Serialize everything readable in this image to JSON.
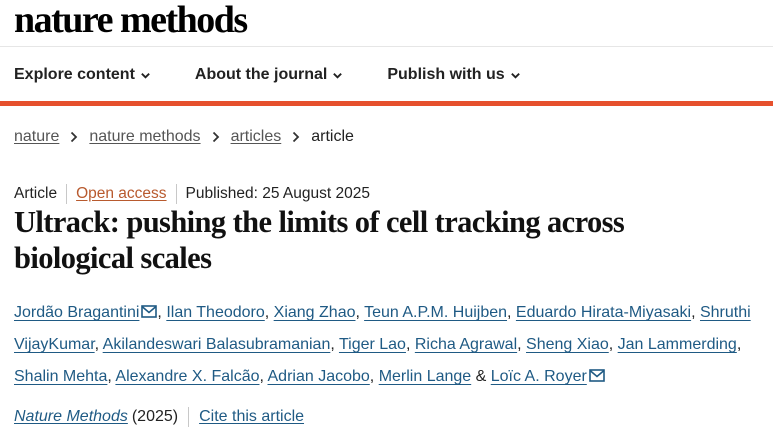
{
  "header": {
    "logo": "nature methods"
  },
  "nav": [
    {
      "label": "Explore content"
    },
    {
      "label": "About the journal"
    },
    {
      "label": "Publish with us"
    }
  ],
  "breadcrumb": {
    "items": [
      "nature",
      "nature methods",
      "articles"
    ],
    "current": "article"
  },
  "meta": {
    "type": "Article",
    "access": "Open access",
    "published": "Published: 25 August 2025"
  },
  "title": "Ultrack: pushing the limits of cell tracking across biological scales",
  "authors": [
    {
      "name": "Jordão Bragantini",
      "mail": true
    },
    {
      "name": "Ilan Theodoro"
    },
    {
      "name": "Xiang Zhao"
    },
    {
      "name": "Teun A.P.M. Huijben"
    },
    {
      "name": "Eduardo Hirata-Miyasaki"
    },
    {
      "name": "Shruthi VijayKumar"
    },
    {
      "name": "Akilandeswari Balasubramanian"
    },
    {
      "name": "Tiger Lao"
    },
    {
      "name": "Richa Agrawal"
    },
    {
      "name": "Sheng Xiao"
    },
    {
      "name": "Jan Lammerding"
    },
    {
      "name": "Shalin Mehta"
    },
    {
      "name": "Alexandre X. Falcão"
    },
    {
      "name": "Adrian Jacobo"
    },
    {
      "name": "Merlin Lange"
    },
    {
      "name": "Loïc A. Royer",
      "mail": true
    }
  ],
  "author_sep": ",",
  "author_last_sep": "&",
  "citation": {
    "journal": "Nature Methods",
    "year": "(2025)",
    "cite": "Cite this article"
  },
  "colors": {
    "accent_bar": "#e6502d",
    "link": "#1f5a84",
    "open_access": "#b85a2e"
  }
}
